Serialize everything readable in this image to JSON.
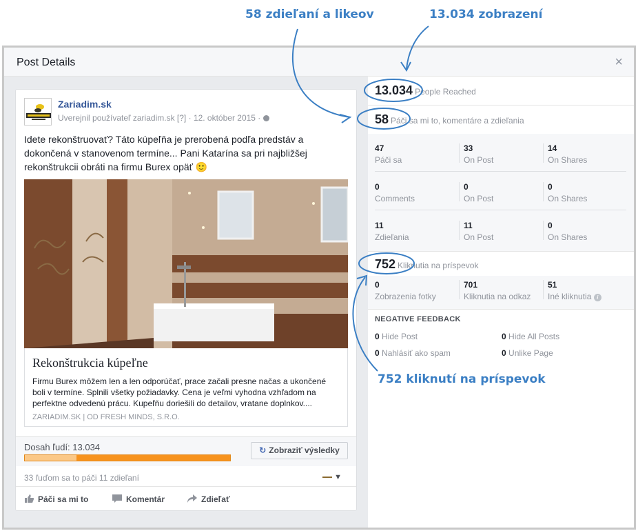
{
  "annotations": {
    "shares_likes": "58 zdieľaní a likeov",
    "views": "13.034 zobrazení",
    "clicks": "752 kliknutí na príspevok",
    "accent_color": "#3b7fc4"
  },
  "modal": {
    "title": "Post Details",
    "close": "×"
  },
  "post": {
    "page_name": "Zariadim.sk",
    "avatar_icon": "zariadim-logo-icon",
    "meta": "Uverejnil používateľ zariadim.sk [?] · 12. október 2015 · ",
    "text": "Idete rekonštruovať? Táto kúpeľňa je prerobená podľa predstáv a dokončená v stanovenom termíne... Pani Katarína sa pri najbližšej rekonštrukcii obráti na firmu Burex opäť 🙂",
    "link": {
      "title": "Rekonštrukcia kúpeľne",
      "description": "Firmu Burex môžem len a len odporúčať, prace začali presne načas a ukončené boli v termíne. Splnili všetky požiadavky. Cena je veľmi vyhodna vzhľadom na perfektne odvedenú prácu. Kupeľňu doriešili do detailov, vratane doplnkov....",
      "source": "ZARIADIM.SK | OD FRESH MINDS, S.R.O."
    },
    "reach_label": "Dosah ľudí: 13.034",
    "results_button": "Zobraziť výsledky",
    "engagement_summary": "33 ľuďom sa to páči   11 zdieľaní",
    "actions": {
      "like": "Páči sa mi to",
      "comment": "Komentár",
      "share": "Zdieľať"
    }
  },
  "stats": {
    "people_reached": {
      "value": "13.034",
      "label": "People Reached"
    },
    "reactions": {
      "value": "58",
      "label": "Páči sa mi to, komentáre a zdieľania"
    },
    "grid": [
      [
        {
          "value": "47",
          "label": "Páči sa"
        },
        {
          "value": "33",
          "label": "On Post"
        },
        {
          "value": "14",
          "label": "On Shares"
        }
      ],
      [
        {
          "value": "0",
          "label": "Comments"
        },
        {
          "value": "0",
          "label": "On Post"
        },
        {
          "value": "0",
          "label": "On Shares"
        }
      ],
      [
        {
          "value": "11",
          "label": "Zdieľania"
        },
        {
          "value": "11",
          "label": "On Post"
        },
        {
          "value": "0",
          "label": "On Shares"
        }
      ]
    ],
    "post_clicks": {
      "value": "752",
      "label": "Kliknutia na príspevok"
    },
    "clicks_breakdown": [
      {
        "value": "0",
        "label": "Zobrazenia fotky"
      },
      {
        "value": "701",
        "label": "Kliknutia na odkaz"
      },
      {
        "value": "51",
        "label": "Iné kliknutia"
      }
    ],
    "negative_feedback": {
      "title": "NEGATIVE FEEDBACK",
      "items": [
        {
          "value": "0",
          "label": "Hide Post"
        },
        {
          "value": "0",
          "label": "Hide All Posts"
        },
        {
          "value": "0",
          "label": "Nahlásiť ako spam"
        },
        {
          "value": "0",
          "label": "Unlike Page"
        }
      ]
    }
  }
}
